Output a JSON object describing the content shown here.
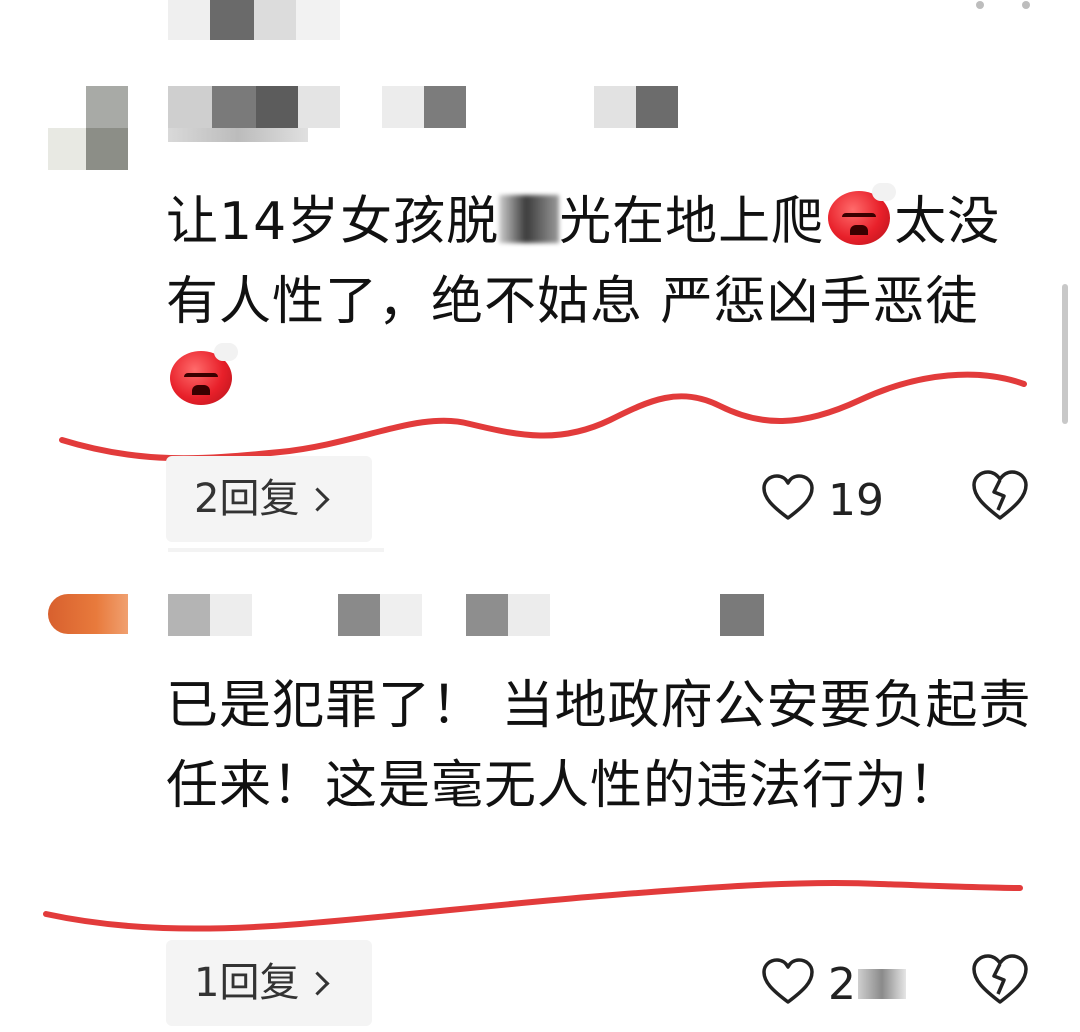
{
  "comments": [
    {
      "text_before_blur": "让14岁女孩脱",
      "text_after_blur": "光在地上爬",
      "text_line_cont": "太没有人性了，绝不姑息 严惩凶手恶徒",
      "reply_count": "2回复",
      "like_count": "19",
      "emoji": "angry-face-emoji"
    },
    {
      "text": "已是犯罪了！ 当地政府公安要负起责任来！这是毫无人性的违法行为！",
      "reply_count": "1回复",
      "like_count": "2",
      "emoji": null
    }
  ],
  "colors": {
    "underline": "#e23b3b",
    "pill_bg": "#f4f4f4",
    "mosaic_dark": "#6e6e6e",
    "mosaic_light": "#e6e6e6"
  },
  "icons": {
    "like": "heart-outline-icon",
    "dislike": "broken-heart-icon",
    "chevron": "chevron-right-icon",
    "more": "more-dots-icon"
  }
}
